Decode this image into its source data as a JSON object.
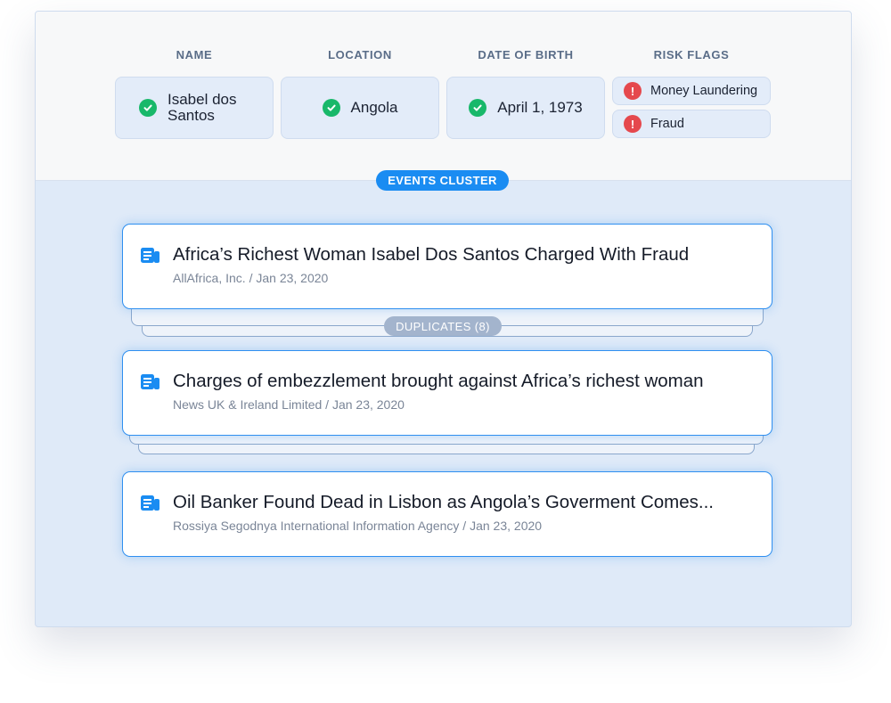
{
  "columns": {
    "name_label": "NAME",
    "location_label": "LOCATION",
    "dob_label": "DATE OF BIRTH",
    "risk_label": "RISK FLAGS"
  },
  "fields": {
    "name_value": "Isabel dos Santos",
    "location_value": "Angola",
    "dob_value": "April 1, 1973"
  },
  "risk_flags": [
    "Money Laundering",
    "Fraud"
  ],
  "events_cluster_label": "EVENTS CLUSTER",
  "duplicates_label": "DUPLICATES (8)",
  "articles": [
    {
      "title": "Africa’s Richest Woman Isabel Dos Santos Charged With Fraud",
      "meta": "AllAfrica, Inc. / Jan 23, 2020"
    },
    {
      "title": "Charges of embezzlement brought against Africa’s richest woman",
      "meta": "News UK & Ireland Limited / Jan 23, 2020"
    },
    {
      "title": "Oil Banker Found Dead in Lisbon as Angola’s Goverment Comes...",
      "meta": "Rossiya Segodnya International Information Agency / Jan 23, 2020"
    }
  ],
  "icons": {
    "verified": "check-circle-icon",
    "risk": "alert-circle-icon",
    "article": "newspaper-icon"
  },
  "colors": {
    "accent": "#1a8cf2",
    "verified": "#18b86a",
    "risk": "#e5484d",
    "panel": "#dfeaf8"
  }
}
